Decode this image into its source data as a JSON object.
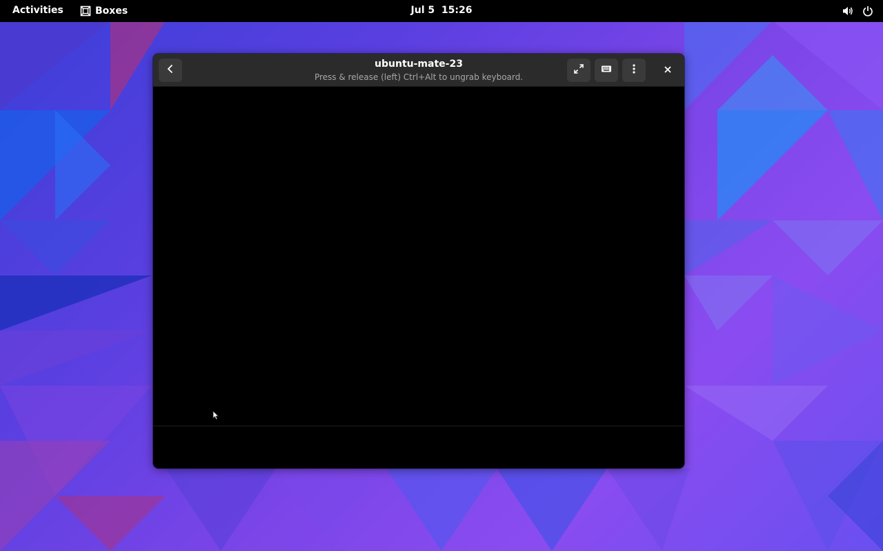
{
  "topbar": {
    "activities_label": "Activities",
    "app_menu_label": "Boxes",
    "app_icon": "boxes-icon",
    "clock": "Jul 5  15:26",
    "status_icons": [
      "volume-icon",
      "power-icon"
    ]
  },
  "window": {
    "title": "ubuntu-mate-23",
    "subtitle": "Press & release (left) Ctrl+Alt to ungrab keyboard.",
    "buttons": {
      "back_icon": "chevron-left-icon",
      "fullscreen_icon": "fullscreen-icon",
      "keyboard_icon": "keyboard-icon",
      "menu_icon": "kebab-menu-icon",
      "close_icon": "close-icon"
    }
  },
  "colors": {
    "topbar_bg": "#000000",
    "headerbar_bg": "#2b2b2b",
    "button_bg": "#3a3a3a",
    "subtitle_text": "#a8a8a8",
    "wallpaper_primary": "#5a3fe0",
    "wallpaper_accent": "#1e6ff0"
  }
}
